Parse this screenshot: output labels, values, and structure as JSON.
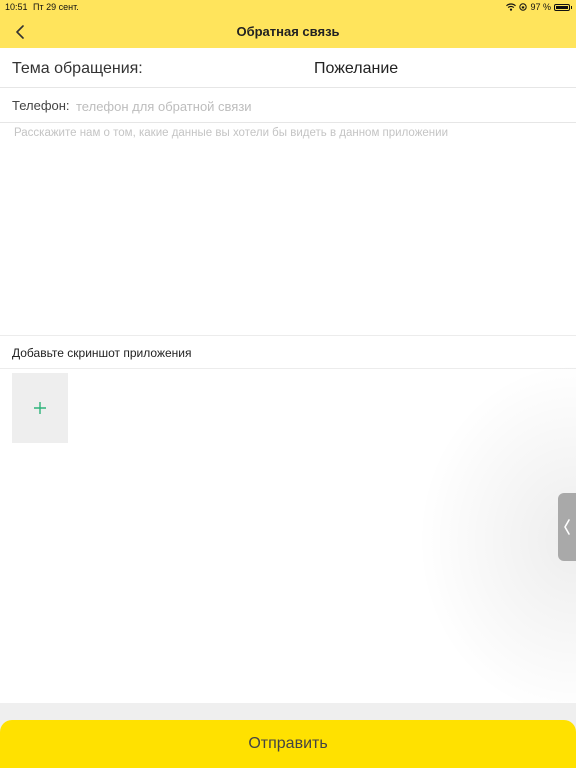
{
  "status_bar": {
    "time": "10:51",
    "date": "Пт 29 сент.",
    "battery": "97 %",
    "battery_level": 0.97
  },
  "nav": {
    "title": "Обратная связь",
    "back_icon": "chevron-left-icon"
  },
  "form": {
    "topic_label": "Тема обращения:",
    "topic_value": "Пожелание",
    "phone_label": "Телефон:",
    "phone_placeholder": "телефон для обратной связи",
    "phone_value": "",
    "message_placeholder": "Расскажите нам о том, какие данные вы хотели бы видеть в данном приложении",
    "message_value": "",
    "screenshot_label": "Добавьте скриншот приложения",
    "add_icon": "plus-icon"
  },
  "submit_label": "Отправить",
  "colors": {
    "header": "#FFE45C",
    "submit": "#FFE100",
    "accent_green": "#2DB37A"
  }
}
